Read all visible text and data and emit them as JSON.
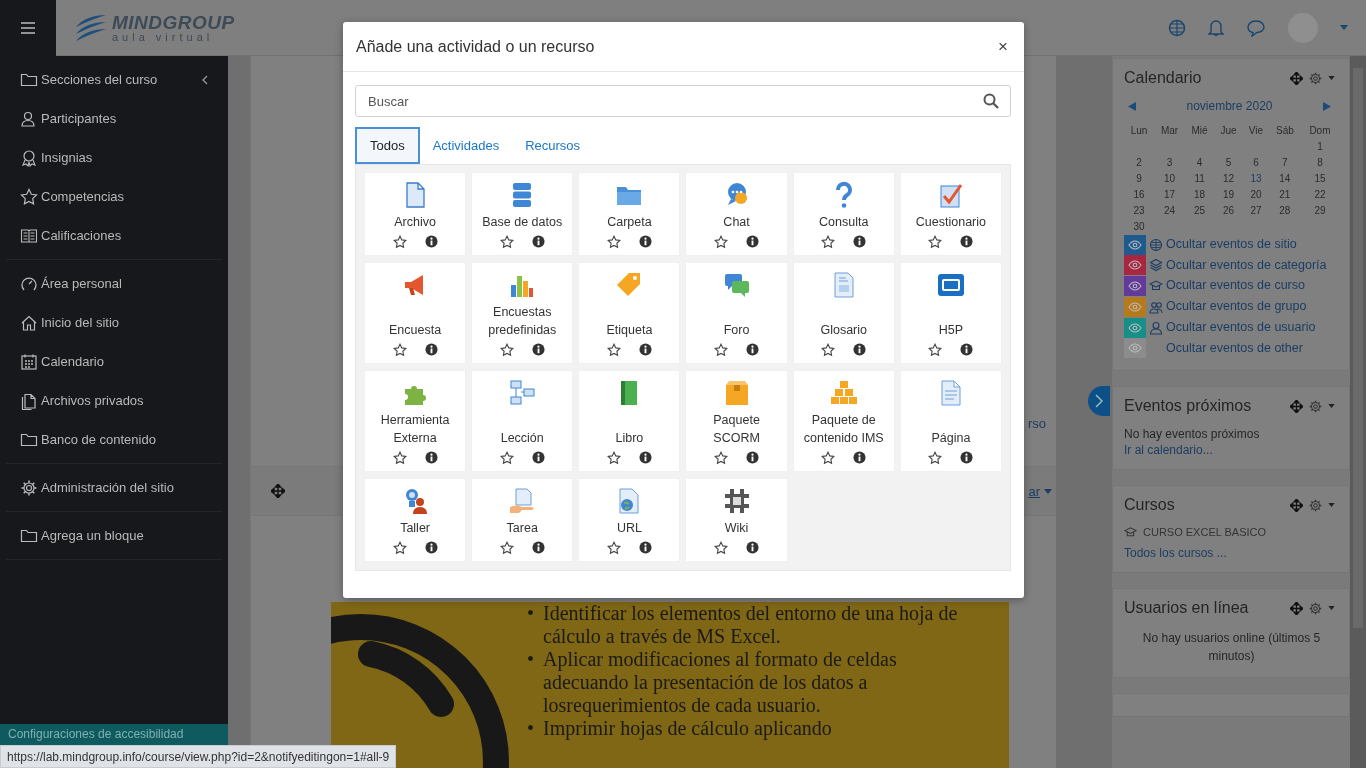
{
  "navbar": {
    "logo_title": "MINDGROUP",
    "logo_subtitle": "aula virtual"
  },
  "sidebar": {
    "groups": [
      {
        "items": [
          {
            "label": "Secciones del curso",
            "kind": "collapsible"
          },
          {
            "label": "Participantes",
            "kind": "link"
          },
          {
            "label": "Insignias",
            "kind": "link"
          },
          {
            "label": "Competencias",
            "kind": "link"
          },
          {
            "label": "Calificaciones",
            "kind": "link"
          }
        ]
      },
      {
        "items": [
          {
            "label": "Área personal",
            "kind": "link"
          },
          {
            "label": "Inicio del sitio",
            "kind": "link"
          },
          {
            "label": "Calendario",
            "kind": "link"
          },
          {
            "label": "Archivos privados",
            "kind": "link"
          },
          {
            "label": "Banco de contenido",
            "kind": "link"
          }
        ]
      },
      {
        "items": [
          {
            "label": "Administración del sitio",
            "kind": "link"
          }
        ]
      },
      {
        "items": [
          {
            "label": "Agrega un bloque",
            "kind": "link"
          }
        ]
      }
    ],
    "accessibility": "Configuraciones de accesibilidad"
  },
  "course": {
    "link_fragment": "rso",
    "menu_fragment": "ar",
    "banner_items": [
      {
        "marker": "•",
        "text": "Identificar los elementos del entorno de una hoja de cálculo a través de MS Excel."
      },
      {
        "marker": "•",
        "text": "Aplicar modificaciones al formato de celdas adecuando la presentación de los datos a losrequerimientos de cada usuario."
      },
      {
        "marker": "•",
        "text": "Imprimir hojas de cálculo aplicando"
      }
    ]
  },
  "modal": {
    "title": "Añade una actividad o un recurso",
    "close": "×",
    "search": {
      "placeholder": "Buscar"
    },
    "tabs": [
      {
        "label": "Todos",
        "selected": true
      },
      {
        "label": "Actividades",
        "selected": false
      },
      {
        "label": "Recursos",
        "selected": false
      }
    ],
    "items": [
      {
        "name": "Archivo",
        "starred": false
      },
      {
        "name": "Base de datos",
        "starred": false
      },
      {
        "name": "Carpeta",
        "starred": false
      },
      {
        "name": "Chat",
        "starred": false
      },
      {
        "name": "Consulta",
        "starred": false
      },
      {
        "name": "Cuestionario",
        "starred": false
      },
      {
        "name": "Encuesta",
        "starred": false
      },
      {
        "name": "Encuestas predefinidas",
        "starred": false
      },
      {
        "name": "Etiqueta",
        "starred": false
      },
      {
        "name": "Foro",
        "starred": false
      },
      {
        "name": "Glosario",
        "starred": false
      },
      {
        "name": "H5P",
        "starred": false
      },
      {
        "name": "Herramienta Externa",
        "starred": false
      },
      {
        "name": "Lección",
        "starred": false
      },
      {
        "name": "Libro",
        "starred": false
      },
      {
        "name": "Paquete SCORM",
        "starred": false
      },
      {
        "name": "Paquete de contenido IMS",
        "starred": false
      },
      {
        "name": "Página",
        "starred": false
      },
      {
        "name": "Taller",
        "starred": false
      },
      {
        "name": "Tarea",
        "starred": false
      },
      {
        "name": "URL",
        "starred": false
      },
      {
        "name": "Wiki",
        "starred": false
      }
    ]
  },
  "calendar": {
    "title": "Calendario",
    "month": "noviembre 2020",
    "weekdays": [
      "Lun",
      "Mar",
      "Mié",
      "Jue",
      "Vie",
      "Sáb",
      "Dom"
    ],
    "weeks": [
      [
        {
          "label": "1",
          "today": false
        }
      ],
      [
        {
          "label": "2",
          "today": false
        },
        {
          "label": "3",
          "today": false
        },
        {
          "label": "4",
          "today": false
        },
        {
          "label": "5",
          "today": false
        },
        {
          "label": "6",
          "today": false
        },
        {
          "label": "7",
          "today": false
        },
        {
          "label": "8",
          "today": false
        }
      ],
      [
        {
          "label": "9",
          "today": false
        },
        {
          "label": "10",
          "today": false
        },
        {
          "label": "11",
          "today": false
        },
        {
          "label": "12",
          "today": false
        },
        {
          "label": "13",
          "today": true
        },
        {
          "label": "14",
          "today": false
        },
        {
          "label": "15",
          "today": false
        }
      ],
      [
        {
          "label": "16",
          "today": false
        },
        {
          "label": "17",
          "today": false
        },
        {
          "label": "18",
          "today": false
        },
        {
          "label": "19",
          "today": false
        },
        {
          "label": "20",
          "today": false
        },
        {
          "label": "21",
          "today": false
        },
        {
          "label": "22",
          "today": false
        }
      ],
      [
        {
          "label": "23",
          "today": false
        },
        {
          "label": "24",
          "today": false
        },
        {
          "label": "25",
          "today": false
        },
        {
          "label": "26",
          "today": false
        },
        {
          "label": "27",
          "today": false
        },
        {
          "label": "28",
          "today": false
        },
        {
          "label": "29",
          "today": false
        }
      ],
      [
        {
          "label": "30",
          "today": false
        }
      ]
    ],
    "filters": [
      {
        "label": "Ocultar eventos de sitio",
        "color": "#1f5a8e"
      },
      {
        "label": "Ocultar eventos de categoría",
        "color": "#a8263f"
      },
      {
        "label": "Ocultar eventos de curso",
        "color": "#623a99"
      },
      {
        "label": "Ocultar eventos de grupo",
        "color": "#b57a1c"
      },
      {
        "label": "Ocultar eventos de usuario",
        "color": "#158f87"
      },
      {
        "label": "Ocultar eventos de other",
        "color": "#8c8c8c"
      }
    ]
  },
  "upcoming": {
    "title": "Eventos próximos",
    "message": "No hay eventos próximos",
    "link": "Ir al calendario..."
  },
  "courses": {
    "title": "Cursos",
    "course": "CURSO EXCEL BASICO",
    "link": "Todos los cursos ..."
  },
  "online": {
    "title": "Usuarios en línea",
    "message": "No hay usuarios online (últimos 5 minutos)"
  },
  "status_bar": {
    "url": "https://lab.mindgroup.info/course/view.php?id=2&notifyeditingon=1#all-9"
  }
}
